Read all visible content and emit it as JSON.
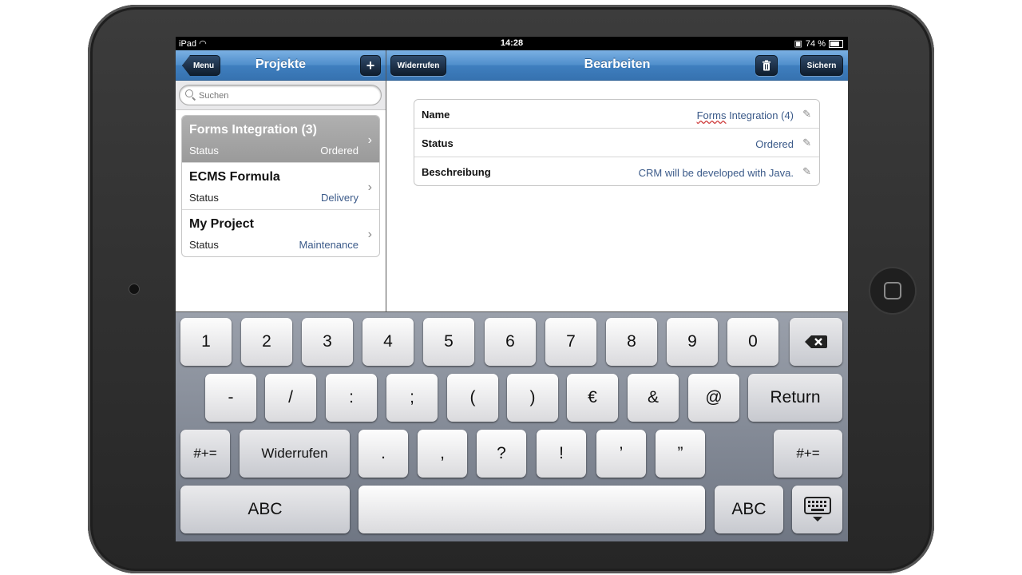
{
  "status_bar": {
    "device": "iPad",
    "time": "14:28",
    "battery": "74 %"
  },
  "master": {
    "nav": {
      "back_label": "Menu",
      "title": "Projekte",
      "add_label": "+"
    },
    "search": {
      "placeholder": "Suchen"
    },
    "projects": [
      {
        "title": "Forms Integration (3)",
        "status_label": "Status",
        "status_value": "Ordered",
        "selected": true
      },
      {
        "title": "ECMS Formula",
        "status_label": "Status",
        "status_value": "Delivery",
        "selected": false
      },
      {
        "title": "My Project",
        "status_label": "Status",
        "status_value": "Maintenance",
        "selected": false
      }
    ]
  },
  "detail": {
    "nav": {
      "undo_label": "Widerrufen",
      "title": "Bearbeiten",
      "save_label": "Sichern"
    },
    "fields": [
      {
        "label": "Name",
        "value_underlined": "Forms",
        "value_rest": " Integration (4)"
      },
      {
        "label": "Status",
        "value": "Ordered"
      },
      {
        "label": "Beschreibung",
        "value": "CRM will be developed with Java."
      }
    ]
  },
  "keyboard": {
    "row1": [
      "1",
      "2",
      "3",
      "4",
      "5",
      "6",
      "7",
      "8",
      "9",
      "0"
    ],
    "row2": [
      "-",
      "/",
      ":",
      ";",
      "(",
      ")",
      "€",
      "&",
      "@"
    ],
    "return_label": "Return",
    "shift_label": "#+=",
    "undo_label": "Widerrufen",
    "row3": [
      ".",
      ",",
      "?",
      "!",
      "’",
      "”"
    ],
    "abc_label": "ABC"
  }
}
